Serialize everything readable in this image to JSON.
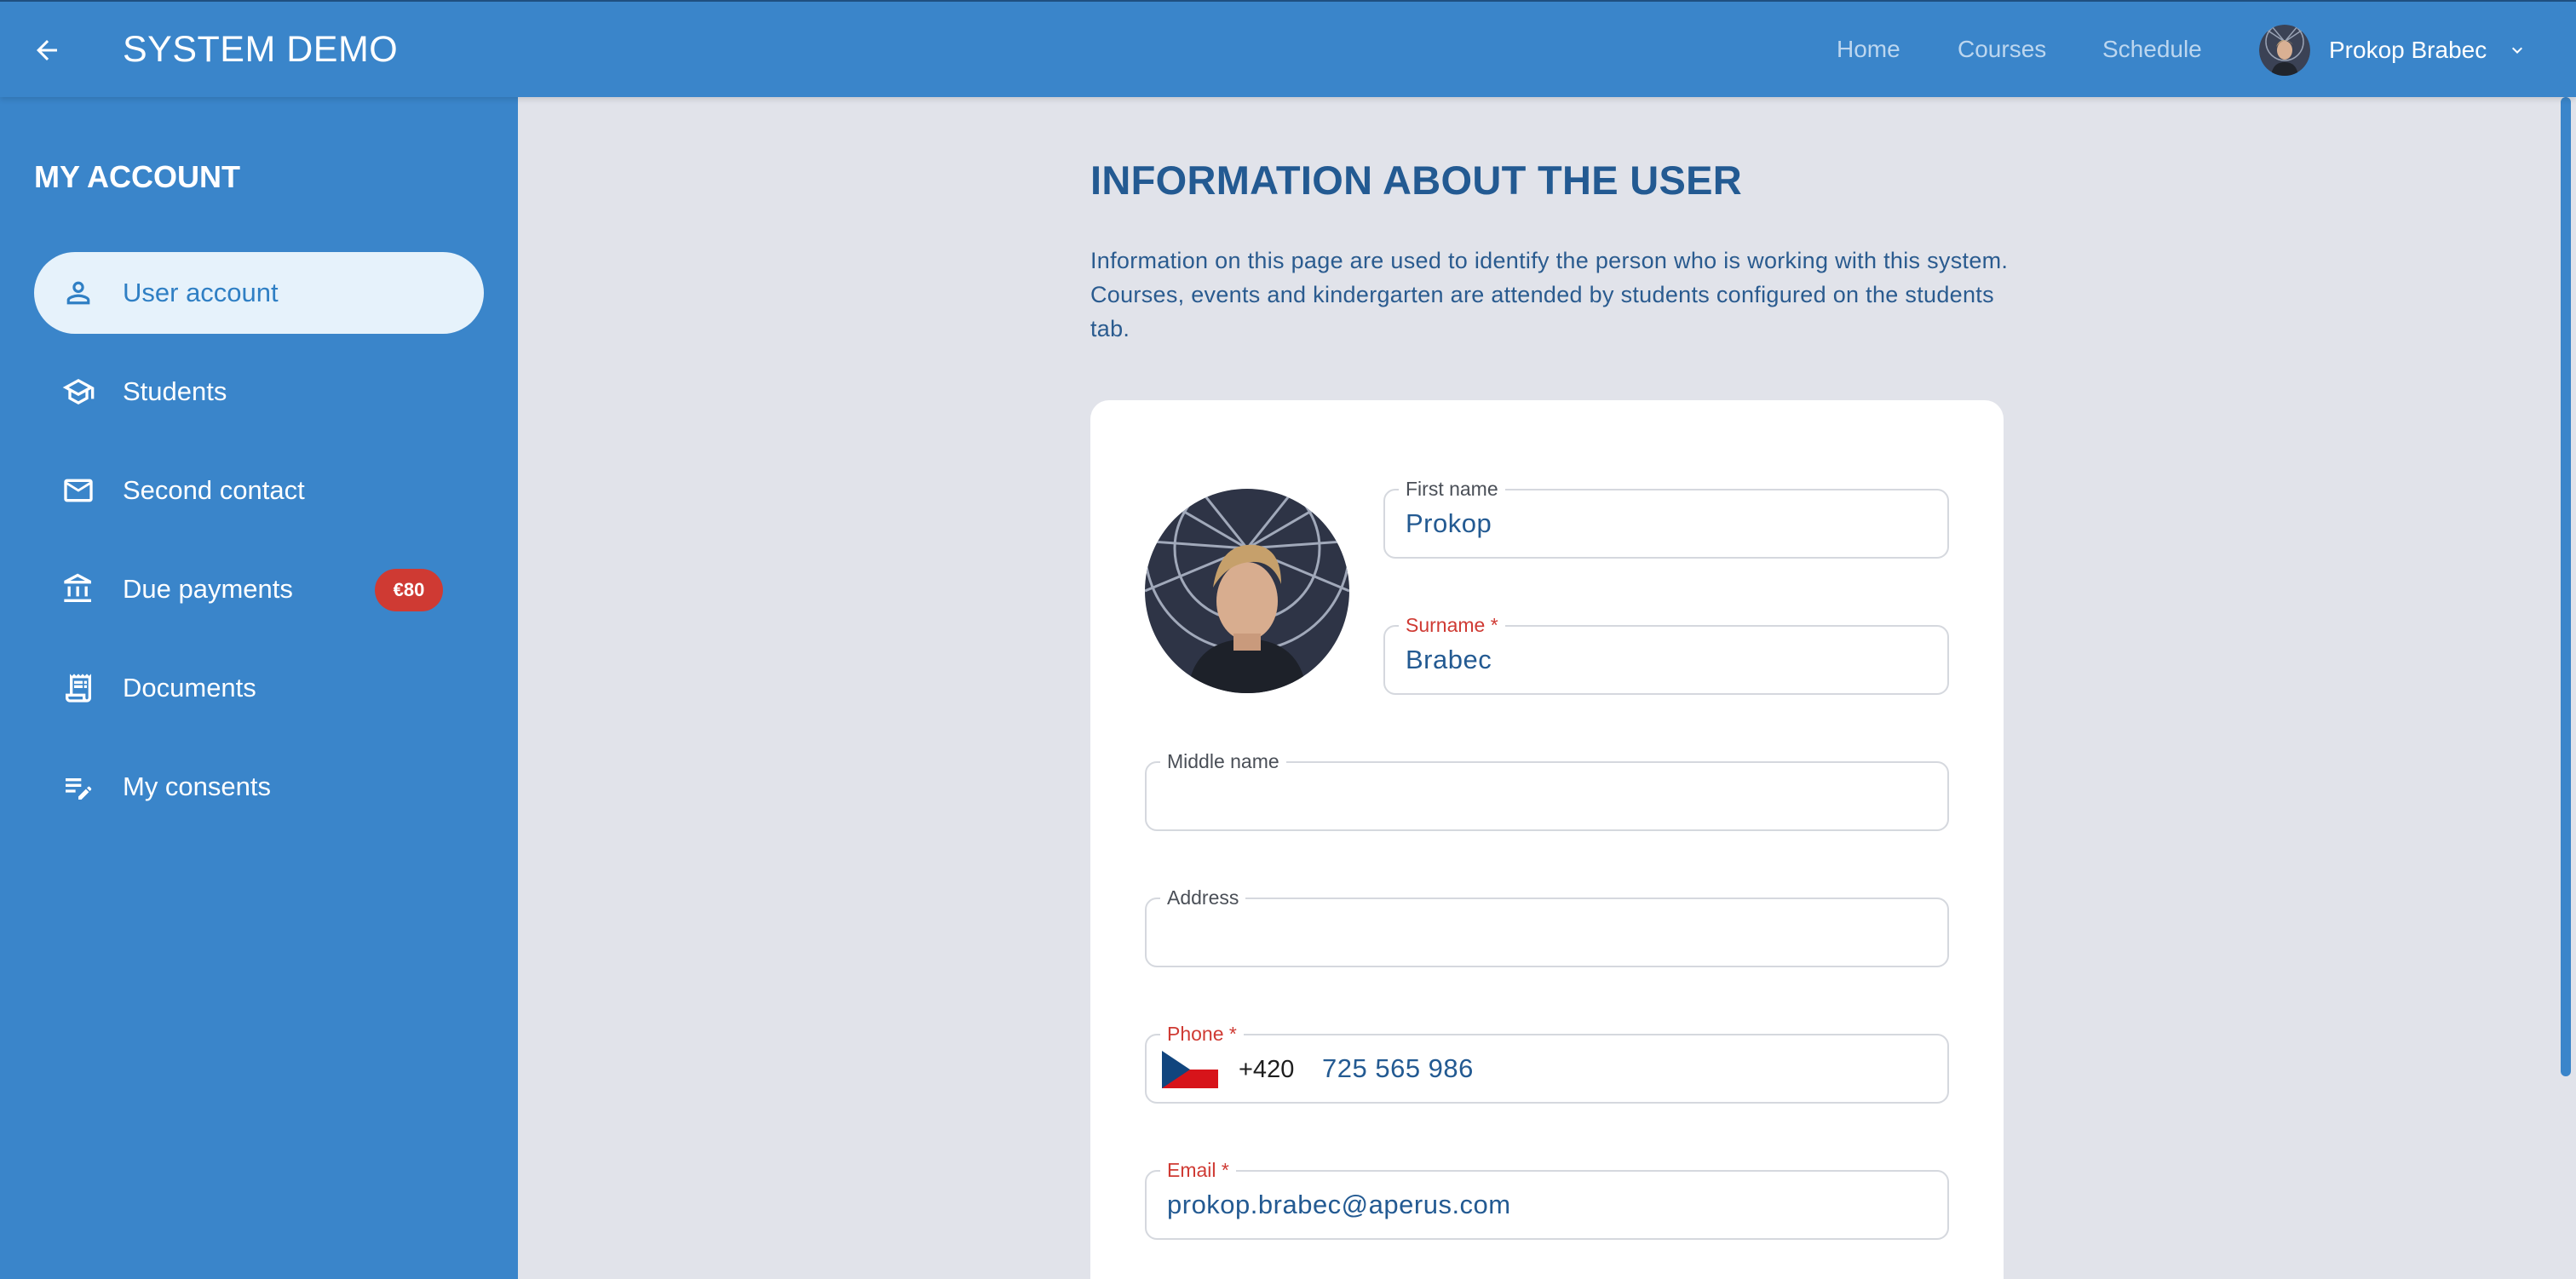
{
  "header": {
    "title": "SYSTEM DEMO",
    "back_icon": "arrow-left-icon",
    "nav": [
      {
        "label": "Home"
      },
      {
        "label": "Courses"
      },
      {
        "label": "Schedule"
      }
    ],
    "user": {
      "name": "Prokop Brabec",
      "menu_icon": "chevron-down-icon"
    }
  },
  "sidebar": {
    "heading": "MY ACCOUNT",
    "items": [
      {
        "label": "User account",
        "icon": "person-icon",
        "active": true
      },
      {
        "label": "Students",
        "icon": "graduation-cap-icon"
      },
      {
        "label": "Second contact",
        "icon": "envelope-icon"
      },
      {
        "label": "Due payments",
        "icon": "bank-icon",
        "badge": "€80"
      },
      {
        "label": "Documents",
        "icon": "receipt-icon"
      },
      {
        "label": "My consents",
        "icon": "list-edit-icon"
      }
    ]
  },
  "main": {
    "title": "INFORMATION ABOUT THE USER",
    "description": "Information on this page are used to identify the person who is working with this system. Courses, events and kindergarten are attended by students configured on the students tab.",
    "form": {
      "first_name": {
        "label": "First name",
        "value": "Prokop"
      },
      "surname": {
        "label": "Surname *",
        "value": "Brabec"
      },
      "middle_name": {
        "label": "Middle name",
        "value": ""
      },
      "address": {
        "label": "Address",
        "value": ""
      },
      "phone": {
        "label": "Phone *",
        "dial_code": "+420",
        "value": "725 565 986"
      },
      "email": {
        "label": "Email *",
        "value": "prokop.brabec@aperus.com"
      }
    }
  },
  "colors": {
    "brand_blue": "#3a85ca",
    "title_blue": "#235a92",
    "required_red": "#cf3a33",
    "background": "#e1e3ea"
  }
}
